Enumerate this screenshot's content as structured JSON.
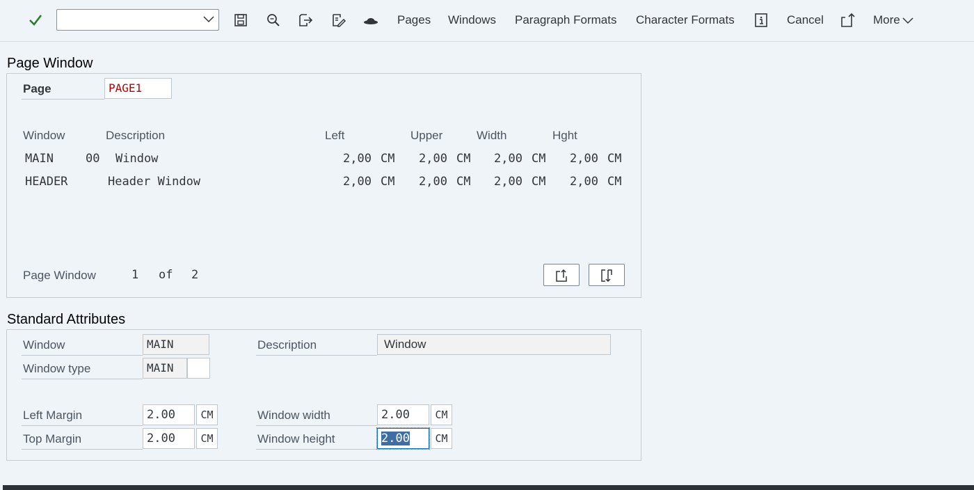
{
  "toolbar": {
    "combo_value": "",
    "pages_label": "Pages",
    "windows_label": "Windows",
    "paragraph_formats_label": "Paragraph Formats",
    "character_formats_label": "Character Formats",
    "cancel_label": "Cancel",
    "more_label": "More",
    "icons": [
      "checkmark-icon",
      "save-icon",
      "find-icon",
      "exit-icon",
      "edit-icon",
      "hat-icon",
      "info-icon",
      "upload-icon",
      "chevron-down-icon"
    ]
  },
  "page_window": {
    "title": "Page Window",
    "page_label": "Page",
    "page_value": "PAGE1",
    "columns": {
      "window": "Window",
      "description": "Description",
      "left": "Left",
      "upper": "Upper",
      "width": "Width",
      "hght": "Hght"
    },
    "rows": [
      {
        "window": "MAIN",
        "num": "00",
        "description": "Window",
        "left": "2,00",
        "left_unit": "CM",
        "upper": "2,00",
        "upper_unit": "CM",
        "width": "2,00",
        "width_unit": "CM",
        "hght": "2,00",
        "hght_unit": "CM"
      },
      {
        "window": "HEADER",
        "num": "",
        "description": "Header Window",
        "left": "2,00",
        "left_unit": "CM",
        "upper": "2,00",
        "upper_unit": "CM",
        "width": "2,00",
        "width_unit": "CM",
        "hght": "2,00",
        "hght_unit": "CM"
      }
    ],
    "pager": {
      "label": "Page Window",
      "current": "1",
      "of": "of",
      "total": "2"
    }
  },
  "standard_attributes": {
    "title": "Standard Attributes",
    "window_label": "Window",
    "window_value": "MAIN",
    "description_label": "Description",
    "description_value": "Window",
    "window_type_label": "Window type",
    "window_type_value": "MAIN",
    "window_type_extra": "",
    "left_margin_label": "Left Margin",
    "left_margin_value": "2.00",
    "left_margin_unit": "CM",
    "top_margin_label": "Top Margin",
    "top_margin_value": "2.00",
    "top_margin_unit": "CM",
    "window_width_label": "Window width",
    "window_width_value": "2.00",
    "window_width_unit": "CM",
    "window_height_label": "Window height",
    "window_height_value": "2.00",
    "window_height_unit": "CM"
  },
  "colors": {
    "background": "#eff4f9",
    "accent": "#0a6ed1",
    "check": "#2b7c2b",
    "red_value": "#bb0000"
  }
}
